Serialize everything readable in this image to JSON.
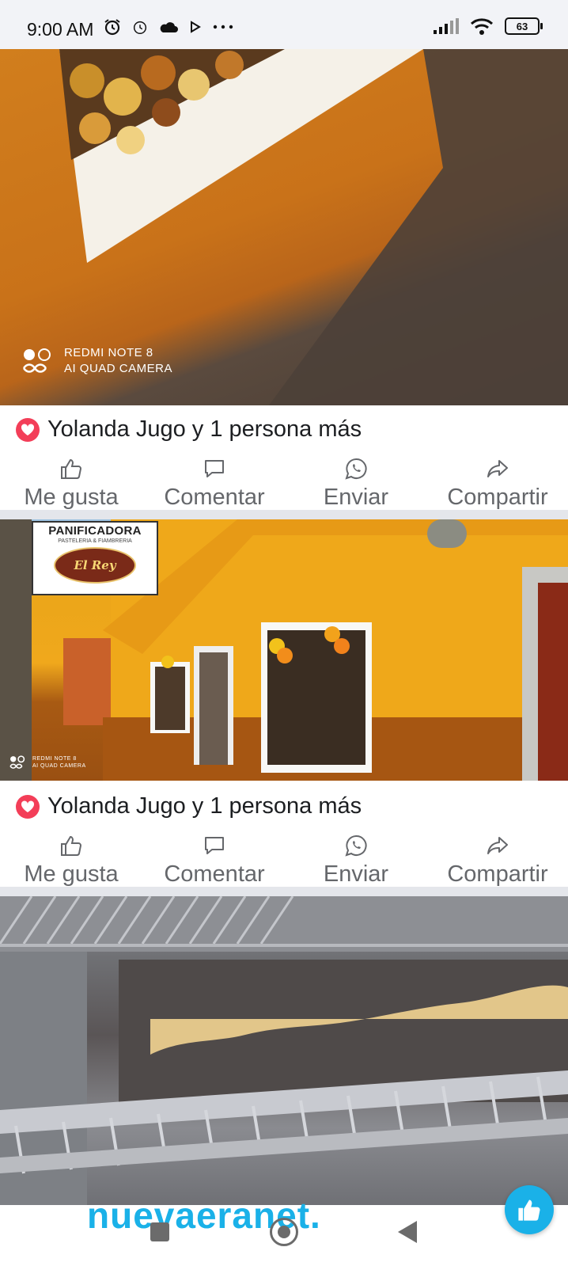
{
  "status_bar": {
    "time": "9:00 AM",
    "battery": "63",
    "left_icons": [
      "alarm-icon",
      "alarm-clock-icon",
      "cloud-icon",
      "play-icon",
      "more-dots-icon"
    ],
    "right_icons": [
      "signal-icon",
      "wifi-icon",
      "battery-icon"
    ]
  },
  "posts": [
    {
      "watermark": {
        "line1": "REDMI NOTE 8",
        "line2": "AI QUAD CAMERA"
      },
      "reactions": "Yolanda Jugo y 1 persona más",
      "actions": [
        "Me gusta",
        "Comentar",
        "Enviar",
        "Compartir"
      ]
    },
    {
      "sign": {
        "title": "PANIFICADORA",
        "subtitle": "PASTELERIA & FIAMBRERIA",
        "name": "El Rey"
      },
      "watermark": {
        "line1": "REDMI NOTE 8",
        "line2": "AI QUAD CAMERA"
      },
      "reactions": "Yolanda Jugo y 1 persona más",
      "actions": [
        "Me gusta",
        "Comentar",
        "Enviar",
        "Compartir"
      ]
    },
    {
      "photo": "bread-display-shelf"
    }
  ],
  "brand": "nuevaeranet.",
  "colors": {
    "reaction_heart": "#f33e58",
    "action_text": "#65676b",
    "brand": "#1ab1e8",
    "separator": "#e4e6eb"
  }
}
